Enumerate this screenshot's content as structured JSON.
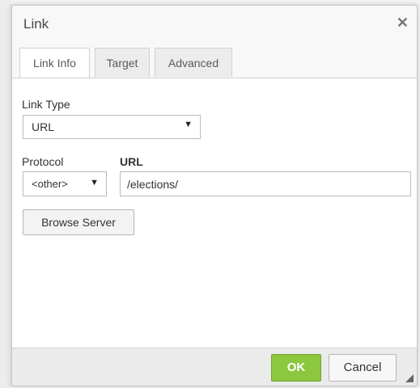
{
  "dialog": {
    "title": "Link",
    "close_glyph": "✕"
  },
  "tabs": [
    {
      "label": "Link Info",
      "active": true
    },
    {
      "label": "Target",
      "active": false
    },
    {
      "label": "Advanced",
      "active": false
    }
  ],
  "form": {
    "link_type_label": "Link Type",
    "link_type_value": "URL",
    "protocol_label": "Protocol",
    "protocol_value": "<other>",
    "url_label": "URL",
    "url_value": "/elections/",
    "browse_button": "Browse Server"
  },
  "footer": {
    "ok_label": "OK",
    "cancel_label": "Cancel"
  },
  "colors": {
    "ok_green": "#8dc63f",
    "border": "#bcbcbc"
  },
  "icons": {
    "close": "close-icon",
    "dropdown": "chevron-down-icon",
    "resize": "resize-grip-icon"
  }
}
